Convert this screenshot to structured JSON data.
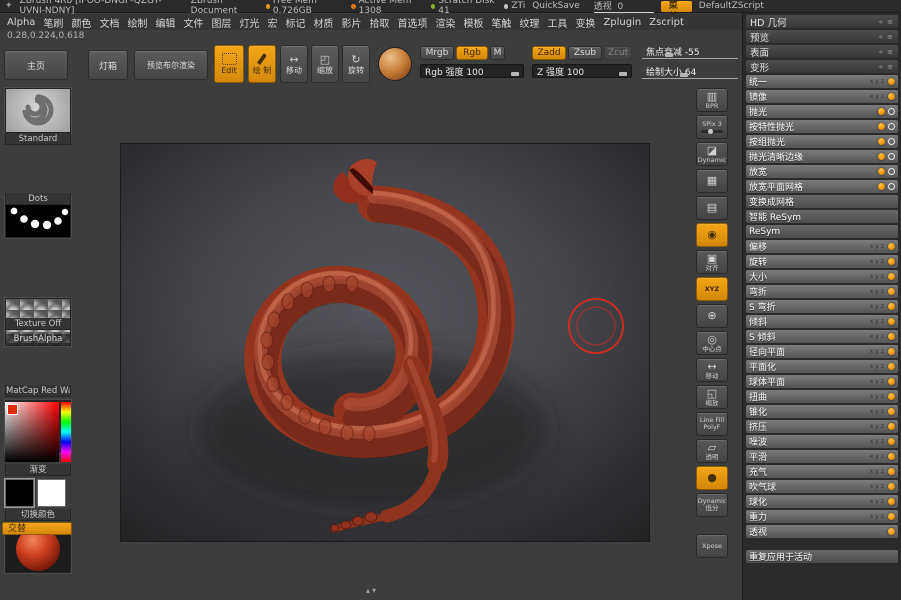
{
  "colors": {
    "accent": "#ef9a0f",
    "free_mem_dot": "#e89b0f",
    "active_mem_dot": "#e8700f",
    "scratch_dot": "#86b32d",
    "zti_dot": "#c5c5c5",
    "cursor_red": "#cc2b20"
  },
  "titlebar": {
    "app_title": "ZBrush 4R8 [IPOO-DNGF-QZGT-UVNI-NDNY]",
    "doc_title": "ZBrush Document",
    "free_mem": "Free Mem 0.726GB",
    "active_mem": "Active Mem 1308",
    "scratch_disk": "Scratch Disk 41",
    "zti": "ZTi",
    "quicksave": "QuickSave",
    "perspective_label": "透视",
    "perspective_value": "0",
    "menu_button": "菜单",
    "zscript": "DefaultZScript"
  },
  "menubar": {
    "items": [
      "Alpha",
      "笔刷",
      "颜色",
      "文档",
      "绘制",
      "编辑",
      "文件",
      "图层",
      "灯光",
      "宏",
      "标记",
      "材质",
      "影片",
      "拾取",
      "首选项",
      "渲染",
      "模板",
      "笔触",
      "纹理",
      "工具",
      "变换",
      "Zplugin",
      "Zscript"
    ]
  },
  "coords": "0.28,0.224,0.618",
  "topshelf": {
    "home": "主页",
    "lightbox": "灯箱",
    "preview_boolean": "预览布尔渲染",
    "edit": "Edit",
    "draw": "绘 制",
    "move": "移动",
    "scale": "缩放",
    "rotate": "旋转",
    "mrgb": "Mrgb",
    "rgb": "Rgb",
    "m": "M",
    "rgb_intensity_label": "Rgb 强度",
    "rgb_intensity_value": "100",
    "rgb_fill": "88%",
    "zadd": "Zadd",
    "zsub": "Zsub",
    "zcut": "Zcut",
    "z_intensity_label": "Z 强度",
    "z_intensity_value": "100",
    "z_fill": "88%",
    "focal_shift_label": "焦点衰减",
    "focal_shift_value": "-55",
    "focal_fill": "24%",
    "draw_size_label": "绘制大小",
    "draw_size_value": "64",
    "draw_fill": "40%"
  },
  "left_tray": {
    "brush_label": "Standard",
    "stroke_label": "Dots",
    "alpha_label": "BrushAlpha",
    "texture_label": "Texture Off",
    "material_label": "MatCap Red Wa:",
    "gradient_label": "渐变",
    "switch_label": "切换颜色",
    "swap_button": "交替"
  },
  "right_shelf": {
    "items": [
      {
        "name": "bpr-render-button",
        "label": "BPR",
        "glyph": "▥"
      },
      {
        "name": "spix-slider",
        "label": "SPix 3",
        "slider": true
      },
      {
        "name": "dynamic-perspective-button",
        "label": "Dynamic",
        "glyph": "◪"
      },
      {
        "name": "perspective-grid-button",
        "glyph": "▦"
      },
      {
        "name": "floor-grid-button",
        "glyph": "▤"
      },
      {
        "name": "local-symmetry-button",
        "glyph": "◉",
        "active": true
      },
      {
        "name": "frame-button",
        "label": "对齐",
        "glyph": "▣"
      },
      {
        "name": "xyz-button",
        "label": "XYZ",
        "active": true
      },
      {
        "name": "scroll-button",
        "glyph": "⊕"
      },
      {
        "name": "center-button",
        "label": "中心点",
        "glyph": "◎"
      },
      {
        "name": "move-button",
        "label": "移动",
        "glyph": "↔"
      },
      {
        "name": "zoom-button",
        "label": "缩放",
        "glyph": "◱"
      },
      {
        "name": "linefill-polyframe-button",
        "label": "Line Fill",
        "label2": "PolyF"
      },
      {
        "name": "transparency-button",
        "label": "透明",
        "glyph": "▱"
      },
      {
        "name": "material-preview-button",
        "glyph": "●",
        "active": true
      },
      {
        "name": "dynamic-resolution-button",
        "label": "Dynamic",
        "label2": "低分"
      },
      {
        "name": "xpose-button",
        "label": "Xpose",
        "gap": true
      }
    ]
  },
  "right_tray": {
    "headers": [
      {
        "id": "hd-geometry",
        "label": "HD 几何"
      },
      {
        "id": "preview",
        "label": "预览"
      },
      {
        "id": "surface",
        "label": "表面"
      }
    ],
    "section": "变形",
    "rows": [
      {
        "id": "unify",
        "label": "统一",
        "type": "slider",
        "axes": true
      },
      {
        "id": "mirror",
        "label": "镜像",
        "type": "slider",
        "axes": true
      },
      {
        "id": "polish",
        "label": "抛光",
        "type": "slider",
        "alt": true
      },
      {
        "id": "polish-by-features",
        "label": "按特性抛光",
        "type": "slider",
        "alt": true
      },
      {
        "id": "polish-by-groups",
        "label": "按组抛光",
        "type": "slider",
        "alt": true
      },
      {
        "id": "polish-crisp-edges",
        "label": "抛光清晰边缘",
        "type": "slider",
        "alt": true
      },
      {
        "id": "relax",
        "label": "放宽",
        "type": "slider",
        "alt": true
      },
      {
        "id": "relax-plane-grid",
        "label": "放宽平面网格",
        "type": "slider",
        "alt": true
      },
      {
        "id": "morph-to-grid",
        "label": "变换成网格",
        "type": "button"
      },
      {
        "id": "smart-resym",
        "label": "智能 ReSym",
        "type": "button"
      },
      {
        "id": "resym",
        "label": "ReSym",
        "type": "button"
      },
      {
        "id": "offset",
        "label": "偏移",
        "type": "slider",
        "axes": true
      },
      {
        "id": "rotate",
        "label": "旋转",
        "type": "slider",
        "axes": true
      },
      {
        "id": "size",
        "label": "大小",
        "type": "slider",
        "axes": true
      },
      {
        "id": "bend",
        "label": "弯折",
        "type": "slider",
        "axes": true
      },
      {
        "id": "s-bend",
        "label": "S 弯折",
        "type": "slider",
        "axes": true
      },
      {
        "id": "skew",
        "label": "倾斜",
        "type": "slider",
        "axes": true
      },
      {
        "id": "s-skew",
        "label": "S 倾斜",
        "type": "slider",
        "axes": true
      },
      {
        "id": "radial-flatten",
        "label": "径向平面",
        "type": "slider",
        "axes": true
      },
      {
        "id": "flatten",
        "label": "平面化",
        "type": "slider",
        "axes": true
      },
      {
        "id": "spherical-flatten",
        "label": "球体平面",
        "type": "slider",
        "axes": true
      },
      {
        "id": "twist",
        "label": "扭曲",
        "type": "slider",
        "axes": true
      },
      {
        "id": "taper",
        "label": "锥化",
        "type": "slider",
        "axes": true
      },
      {
        "id": "squeeze",
        "label": "挤压",
        "type": "slider",
        "axes": true
      },
      {
        "id": "noise",
        "label": "噪波",
        "type": "slider",
        "axes": true
      },
      {
        "id": "smooth",
        "label": "平滑",
        "type": "slider",
        "axes": true
      },
      {
        "id": "inflate",
        "label": "充气",
        "type": "slider",
        "axes": true
      },
      {
        "id": "inflate-balloon",
        "label": "吹气球",
        "type": "slider",
        "axes": true
      },
      {
        "id": "spherize",
        "label": "球化",
        "type": "slider",
        "axes": true
      },
      {
        "id": "gravity",
        "label": "重力",
        "type": "slider",
        "axes": true
      },
      {
        "id": "perspective",
        "label": "透视",
        "type": "slider",
        "axes": false
      },
      {
        "id": "repeat-to-active",
        "label": "重复应用于活动",
        "type": "button",
        "gap_before": true
      }
    ]
  },
  "canvas": {
    "bottom_marks": "▴▾"
  }
}
